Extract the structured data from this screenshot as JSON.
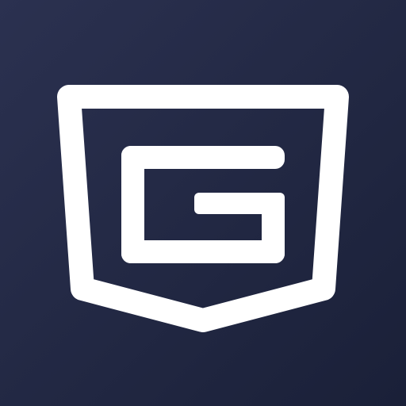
{
  "icon": {
    "name": "pocket-g-logo",
    "background_top": "#2b3150",
    "background_bottom": "#1a2038",
    "foreground": "#ffffff"
  }
}
